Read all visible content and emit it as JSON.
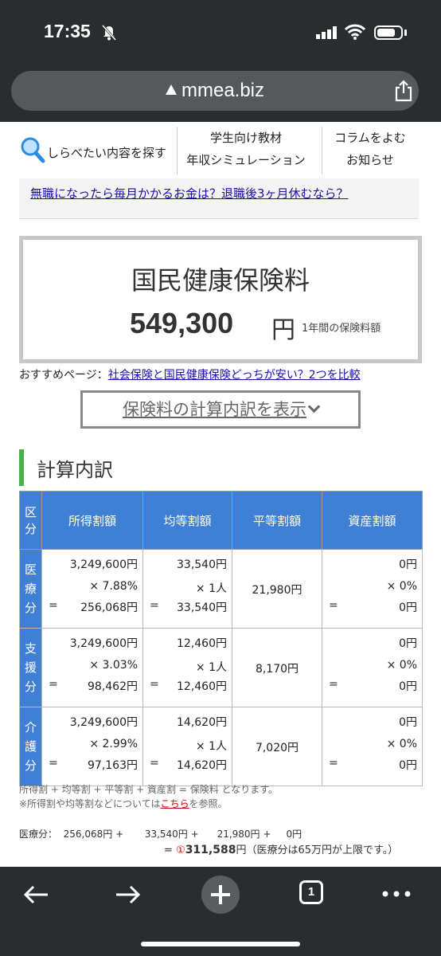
{
  "status": {
    "time": "17:35"
  },
  "browser": {
    "url": "mmea.biz"
  },
  "nav": {
    "search_label": "しらべたい内容を探す",
    "col2": [
      "学生向け教材",
      "年収シミュレーション"
    ],
    "col3": [
      "コラムをよむ",
      "お知らせ"
    ]
  },
  "top_link": "無職になったら毎月かかるお金は？退職後3ヶ月休むなら？",
  "result": {
    "title": "国民健康保険料",
    "amount": "549,300",
    "unit": "円",
    "note": "1年間の保険料額"
  },
  "recommend": {
    "prefix": "おすすめページ：",
    "link": "社会保険と国民健康保険どっちが安い？2つを比較"
  },
  "toggle_label": "保険料の計算内訳を表示",
  "section_title": "計算内訳",
  "table": {
    "headers": [
      "区分",
      "所得割額",
      "均等割額",
      "平等割額",
      "資産割額"
    ],
    "rows": [
      {
        "label": "医療分",
        "income": [
          "3,249,600円",
          "× 7.88%",
          "256,068円"
        ],
        "per_capita": [
          "33,540円",
          "× 1人",
          "33,540円"
        ],
        "flat": "21,980円",
        "asset": [
          "0円",
          "× 0%",
          "0円"
        ]
      },
      {
        "label": "支援分",
        "income": [
          "3,249,600円",
          "× 3.03%",
          "98,462円"
        ],
        "per_capita": [
          "12,460円",
          "× 1人",
          "12,460円"
        ],
        "flat": "8,170円",
        "asset": [
          "0円",
          "× 0%",
          "0円"
        ]
      },
      {
        "label": "介護分",
        "income": [
          "3,249,600円",
          "× 2.99%",
          "97,163円"
        ],
        "per_capita": [
          "14,620円",
          "× 1人",
          "14,620円"
        ],
        "flat": "7,020円",
        "asset": [
          "0円",
          "× 0%",
          "0円"
        ]
      }
    ],
    "eq": "="
  },
  "footnotes": {
    "line1": "所得割 + 均等割 + 平等割 + 資産割 = 保険料 となります。",
    "line2_prefix": "※所得割や均等割などについては",
    "line2_link": "こちら",
    "line2_suffix": "を参照。"
  },
  "summary": {
    "line1": "医療分：  256,068円 +       33,540円 +      21,980円 +     0円",
    "eq": "= ",
    "circle": "①",
    "total": "311,588",
    "suffix": "円（医療分は65万円が上限です。）"
  },
  "icons": {
    "search": "magnifier-icon",
    "accent": "#3f7fd4",
    "section_bar": "#4caf50"
  },
  "toolbar": {
    "tab_count": "1"
  }
}
